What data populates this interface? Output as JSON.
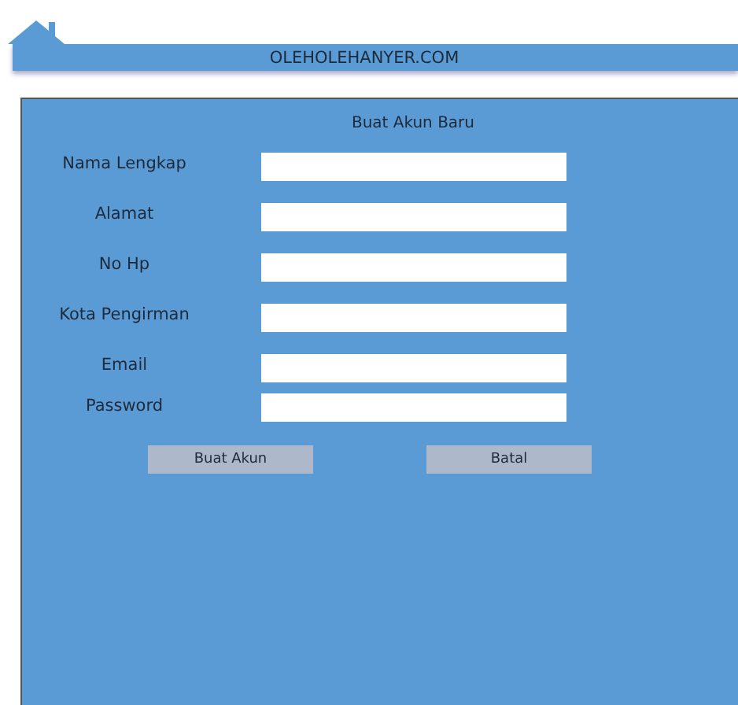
{
  "header": {
    "site_name": "OLEHOLEHANYER.COM"
  },
  "form": {
    "title": "Buat Akun Baru",
    "fields": [
      {
        "label": "Nama Lengkap"
      },
      {
        "label": "Alamat"
      },
      {
        "label": "No Hp"
      },
      {
        "label": "Kota Pengirman"
      },
      {
        "label": "Email"
      },
      {
        "label": "Password"
      }
    ],
    "buttons": [
      "Buat Akun",
      "Batal"
    ]
  }
}
